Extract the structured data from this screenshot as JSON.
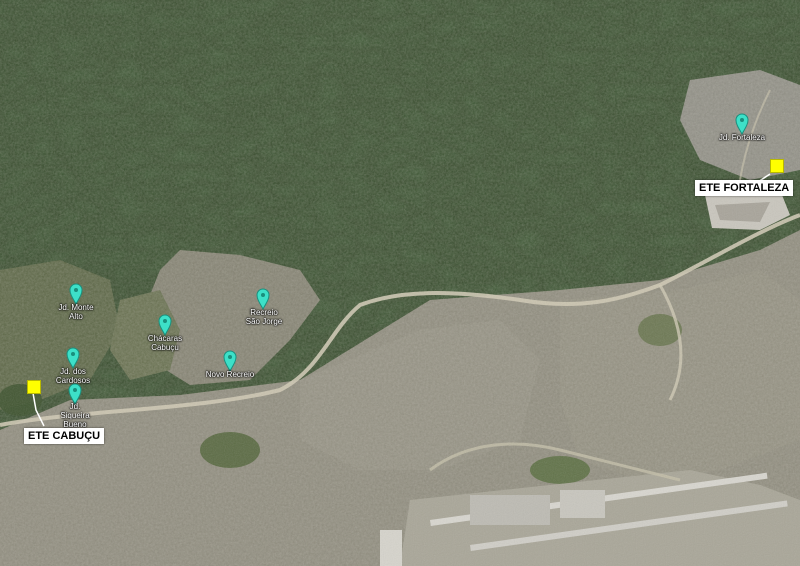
{
  "map": {
    "type": "satellite",
    "colors": {
      "forest": "#2f4a22",
      "urban": "#8e8e84",
      "road": "#c9c3b0",
      "pin": "#3de0c8",
      "ete_marker": "#ffff00"
    }
  },
  "places": [
    {
      "id": "jd-fortaleza",
      "lines": [
        "Jd. Fortaleza"
      ]
    },
    {
      "id": "jd-monte-alto",
      "lines": [
        "Jd. Monte",
        "Alto"
      ]
    },
    {
      "id": "recreio-sao-jorge",
      "lines": [
        "Recreio",
        "São Jorge"
      ]
    },
    {
      "id": "chacaras-cabucu",
      "lines": [
        "Chácaras",
        "Cabuçu"
      ]
    },
    {
      "id": "jd-dos-cardosos",
      "lines": [
        "Jd. dos",
        "Cardosos"
      ]
    },
    {
      "id": "novo-recreio",
      "lines": [
        "Novo Recreio"
      ]
    },
    {
      "id": "jd-siqueira-bueno",
      "lines": [
        "Jd.",
        "Siqueira",
        "Bueno"
      ]
    }
  ],
  "stations": [
    {
      "id": "ete-fortaleza",
      "label": "ETE FORTALEZA"
    },
    {
      "id": "ete-cabucu",
      "label": "ETE CABUÇU"
    }
  ]
}
